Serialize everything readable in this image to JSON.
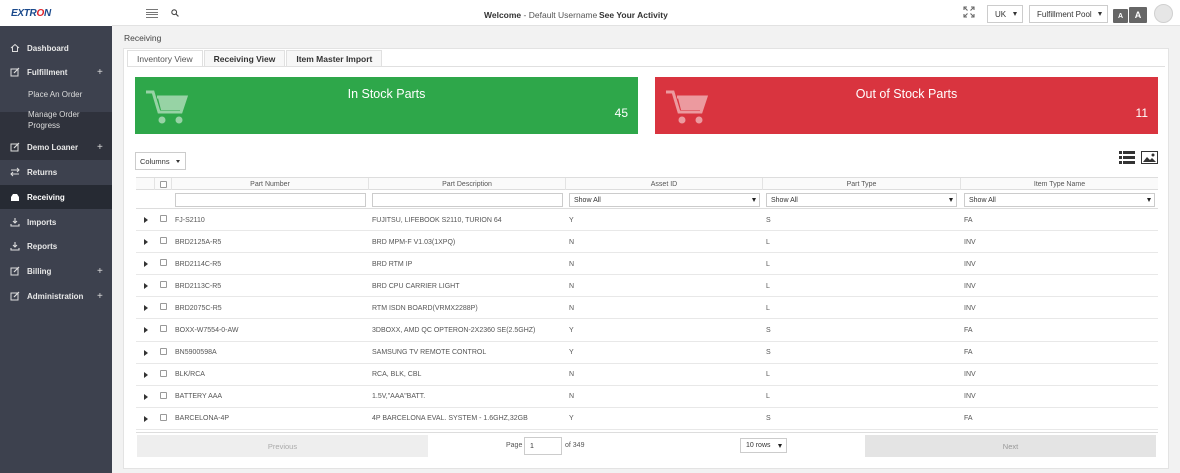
{
  "header": {
    "logo": {
      "pre": "E",
      "x": "X",
      "mid": "TR",
      "o": "O",
      "post": "N"
    },
    "welcome_label": "Welcome",
    "username": "- Default Username",
    "activity_link": "See Your Activity",
    "region": "UK",
    "pool": "Fulfillment Pool",
    "font_small": "A",
    "font_large": "A"
  },
  "sidebar": {
    "items": [
      {
        "label": "Dashboard",
        "icon": "home-icon"
      },
      {
        "label": "Fulfillment",
        "icon": "edit-icon",
        "plus": "+"
      },
      {
        "label": "Demo Loaner",
        "icon": "edit-icon",
        "plus": "+"
      },
      {
        "label": "Returns",
        "icon": "exchange-icon"
      },
      {
        "label": "Receiving",
        "icon": "inbox-icon"
      },
      {
        "label": "Imports",
        "icon": "download-icon"
      },
      {
        "label": "Reports",
        "icon": "download-icon"
      },
      {
        "label": "Billing",
        "icon": "edit-icon",
        "plus": "+"
      },
      {
        "label": "Administration",
        "icon": "edit-icon",
        "plus": "+"
      }
    ],
    "subitems": [
      "Place An Order",
      "Manage Order Progress"
    ]
  },
  "breadcrumb": "Receiving",
  "tabs": [
    "Inventory View",
    "Receiving View",
    "Item Master Import"
  ],
  "cards": {
    "in_stock": {
      "title": "In Stock Parts",
      "count": "45",
      "color": "#2ea74a"
    },
    "out_stock": {
      "title": "Out of Stock Parts",
      "count": "11",
      "color": "#d9343f"
    }
  },
  "columns_button": "Columns",
  "table": {
    "headers": [
      "Part Number",
      "Part Description",
      "Asset ID",
      "Part Type",
      "Item Type Name"
    ],
    "filter_default": "Show All",
    "rows": [
      [
        "FJ-S2110",
        "FUJITSU, LIFEBOOK S2110, TURION 64",
        "Y",
        "S",
        "FA"
      ],
      [
        "BRD2125A-R5",
        "BRD MPM-F V1.03(1XPQ)",
        "N",
        "L",
        "INV"
      ],
      [
        "BRD2114C-R5",
        "BRD RTM IP",
        "N",
        "L",
        "INV"
      ],
      [
        "BRD2113C-R5",
        "BRD CPU CARRIER LIGHT",
        "N",
        "L",
        "INV"
      ],
      [
        "BRD2075C-R5",
        "RTM ISDN BOARD(VRMX2288P)",
        "N",
        "L",
        "INV"
      ],
      [
        "BOXX-W7554-0-AW",
        "3DBOXX, AMD QC OPTERON-2X2360 SE(2.5GHZ)",
        "Y",
        "S",
        "FA"
      ],
      [
        "BN5900598A",
        "SAMSUNG TV REMOTE CONTROL",
        "Y",
        "S",
        "FA"
      ],
      [
        "BLK/RCA",
        "RCA, BLK, CBL",
        "N",
        "L",
        "INV"
      ],
      [
        "BATTERY AAA",
        "1.5V,\"AAA\"BATT.",
        "N",
        "L",
        "INV"
      ],
      [
        "BARCELONA-4P",
        "4P BARCELONA EVAL. SYSTEM - 1.6GHZ,32GB",
        "Y",
        "S",
        "FA"
      ]
    ]
  },
  "pager": {
    "previous": "Previous",
    "next": "Next",
    "page_label": "Page",
    "page_value": "1",
    "of_label": "of 349",
    "rows_label": "10 rows"
  }
}
